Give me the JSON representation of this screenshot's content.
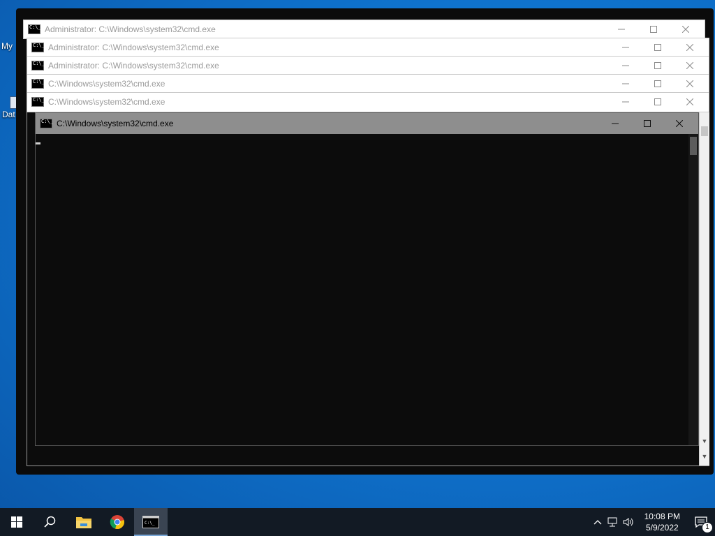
{
  "desktop": {
    "icon_labels": [
      "My",
      "Dat"
    ]
  },
  "windows": [
    {
      "title": "Administrator: C:\\Windows\\system32\\cmd.exe"
    },
    {
      "title": "Administrator: C:\\Windows\\system32\\cmd.exe"
    },
    {
      "title": "Administrator: C:\\Windows\\system32\\cmd.exe"
    },
    {
      "title": "C:\\Windows\\system32\\cmd.exe"
    },
    {
      "title": "C:\\Windows\\system32\\cmd.exe"
    }
  ],
  "active_window": {
    "title": "C:\\Windows\\system32\\cmd.exe"
  },
  "window_controls": {
    "minimize": "—",
    "maximize": "☐",
    "close": "✕"
  },
  "taskbar": {
    "items": [
      "start-icon",
      "search-icon",
      "file-explorer-icon",
      "chrome-icon",
      "cmd-icon"
    ],
    "clock_time": "10:08 PM",
    "clock_date": "5/9/2022",
    "notification_count": "1"
  },
  "colors": {
    "desktop": "#0f74cf",
    "taskbar": "#121a24",
    "active_titlebar": "#8e8e8e",
    "console_bg": "#0c0c0c"
  }
}
